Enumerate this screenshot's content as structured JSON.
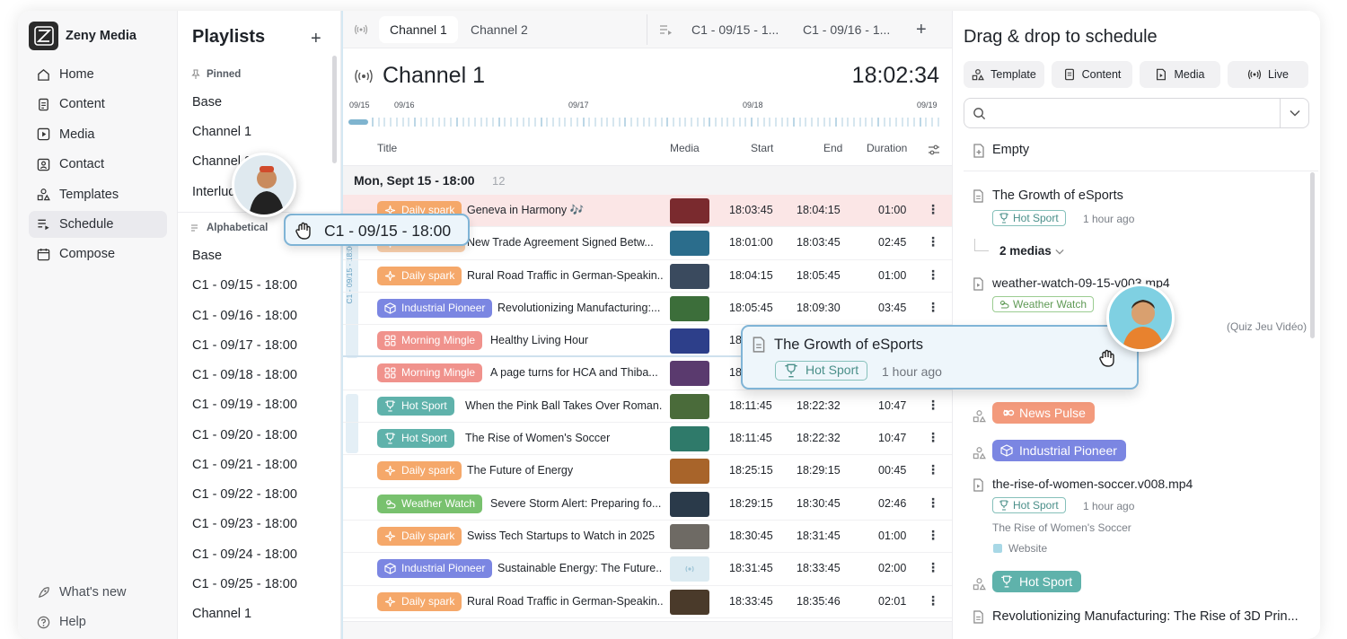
{
  "brand": {
    "name": "Zeny Media"
  },
  "nav": {
    "items": [
      {
        "label": "Home",
        "icon": "home-icon"
      },
      {
        "label": "Content",
        "icon": "document-icon"
      },
      {
        "label": "Media",
        "icon": "play-square-icon"
      },
      {
        "label": "Contact",
        "icon": "contact-icon"
      },
      {
        "label": "Templates",
        "icon": "shapes-icon"
      },
      {
        "label": "Schedule",
        "icon": "schedule-icon",
        "active": true
      },
      {
        "label": "Compose",
        "icon": "calendar-icon"
      }
    ],
    "bottom": [
      {
        "label": "What's new",
        "icon": "rocket-icon"
      },
      {
        "label": "Help",
        "icon": "help-icon"
      }
    ]
  },
  "playlists": {
    "title": "Playlists",
    "pinned_label": "Pinned",
    "pinned": [
      "Base",
      "Channel 1",
      "Channel 2",
      "Interlude"
    ],
    "alphabetical_label": "Alphabetical",
    "alphabetical": [
      "Base",
      "C1 - 09/15 - 18:00",
      "C1 - 09/16 - 18:00",
      "C1 - 09/17 - 18:00",
      "C1 - 09/18 - 18:00",
      "C1 - 09/19 - 18:00",
      "C1 - 09/20 - 18:00",
      "C1 - 09/21 - 18:00",
      "C1 - 09/22 - 18:00",
      "C1 - 09/23 - 18:00",
      "C1 - 09/24 - 18:00",
      "C1 - 09/25 - 18:00",
      "Channel 1"
    ]
  },
  "tabs": {
    "channels": [
      "Channel 1",
      "Channel 2"
    ],
    "playlists": [
      "C1 - 09/15 - 1...",
      "C1 - 09/16 - 1..."
    ]
  },
  "channel": {
    "title": "Channel 1",
    "clock": "18:02:34",
    "timeline_labels": [
      "09/15",
      "09/16",
      "09/17",
      "09/18",
      "09/19"
    ],
    "columns": {
      "title": "Title",
      "media": "Media",
      "start": "Start",
      "end": "End",
      "duration": "Duration"
    },
    "day_header": "Mon, Sept 15 - 18:00",
    "day_count": "12",
    "loop_label": "C1 - 09/15 - 18:00",
    "rows": [
      {
        "tag": "Daily spark",
        "tag_type": "daily",
        "title": "Geneva in Harmony 🎶",
        "start": "18:03:45",
        "end": "18:04:15",
        "duration": "01:00",
        "thumb": "#7a2a2e"
      },
      {
        "tag": "News Pulse",
        "tag_type": "daily",
        "title": "New Trade Agreement Signed Betw...",
        "start": "18:01:00",
        "end": "18:03:45",
        "duration": "02:45",
        "thumb": "#2b6d8c"
      },
      {
        "tag": "Daily spark",
        "tag_type": "daily",
        "title": "Rural Road Traffic in German-Speakin...",
        "start": "18:04:15",
        "end": "18:05:45",
        "duration": "01:00",
        "thumb": "#3a4a5e"
      },
      {
        "tag": "Industrial Pioneer",
        "tag_type": "industrial",
        "title": "Revolutionizing Manufacturing:...",
        "start": "18:05:45",
        "end": "18:09:30",
        "duration": "03:45",
        "thumb": "#3c6e3a"
      },
      {
        "tag": "Morning Mingle",
        "tag_type": "morning",
        "title": "Healthy Living Hour",
        "start": "18:09:30",
        "end": "18:11:45",
        "duration": "02:15",
        "thumb": "#2d3f8a"
      },
      {
        "tag": "Morning Mingle",
        "tag_type": "morning",
        "title": "A page turns for HCA and Thiba...",
        "start": "18:11:45",
        "end": "18:11:45",
        "duration": "00:00",
        "thumb": "#5a3a6e"
      },
      {
        "tag": "Hot Sport",
        "tag_type": "hot",
        "title": "When the Pink Ball Takes Over Roman...",
        "start": "18:11:45",
        "end": "18:22:32",
        "duration": "10:47",
        "thumb": "#4a6b3a"
      },
      {
        "tag": "Hot Sport",
        "tag_type": "hot",
        "title": "The Rise of Women's Soccer",
        "start": "18:11:45",
        "end": "18:22:32",
        "duration": "10:47",
        "thumb": "#2f7a6a"
      },
      {
        "tag": "Daily spark",
        "tag_type": "daily",
        "title": "The Future of Energy",
        "start": "18:25:15",
        "end": "18:29:15",
        "duration": "00:45",
        "thumb": "#a8642a"
      },
      {
        "tag": "Weather Watch",
        "tag_type": "weather",
        "title": "Severe Storm Alert: Preparing fo...",
        "start": "18:29:15",
        "end": "18:30:45",
        "duration": "02:46",
        "thumb": "#2a3a4a"
      },
      {
        "tag": "Daily spark",
        "tag_type": "daily",
        "title": "Swiss Tech Startups to Watch in 2025",
        "start": "18:30:45",
        "end": "18:31:45",
        "duration": "01:00",
        "thumb": "#6e6a64"
      },
      {
        "tag": "Industrial Pioneer",
        "tag_type": "industrial",
        "title": "Sustainable Energy: The Future...",
        "start": "18:31:45",
        "end": "18:33:45",
        "duration": "02:00",
        "thumb": "#dcebf2"
      },
      {
        "tag": "Daily spark",
        "tag_type": "daily",
        "title": "Rural Road Traffic in German-Speakin...",
        "start": "18:33:45",
        "end": "18:35:46",
        "duration": "02:01",
        "thumb": "#4a3a2a"
      }
    ]
  },
  "right_panel": {
    "title": "Drag & drop to schedule",
    "buttons": [
      "Template",
      "Content",
      "Media",
      "Live"
    ],
    "search_placeholder": "",
    "empty": "Empty",
    "items": {
      "esports_title": "The Growth of eSports",
      "esports_tag": "Hot Sport",
      "esports_time": "1 hour ago",
      "medias": "2 medias",
      "weather_file": "weather-watch-09-15-v003.mp4",
      "weather_tag": "Weather Watch",
      "weather_note": "(Quiz Jeu Vidéo)",
      "news_pulse": "News Pulse",
      "industrial": "Industrial Pioneer",
      "women_file": "the-rise-of-women-soccer.v008.mp4",
      "women_tag": "Hot Sport",
      "women_time": "1 hour ago",
      "women_sub": "The Rise of Women's Soccer",
      "women_site": "Website",
      "hot_sport": "Hot Sport",
      "manufacturing": "Revolutionizing Manufacturing: The Rise of 3D Prin..."
    }
  },
  "drag": {
    "pill_label": "C1 - 09/15 - 18:00",
    "card_title": "The Growth of eSports",
    "card_tag": "Hot Sport",
    "card_time": "1 hour ago"
  },
  "colors": {
    "daily": "#f5a86a",
    "industrial": "#7b86e2",
    "morning": "#f0928c",
    "hot": "#5fb2ab",
    "weather": "#78c16e",
    "news": "#f39a7c",
    "accent": "#7fb4d6"
  }
}
